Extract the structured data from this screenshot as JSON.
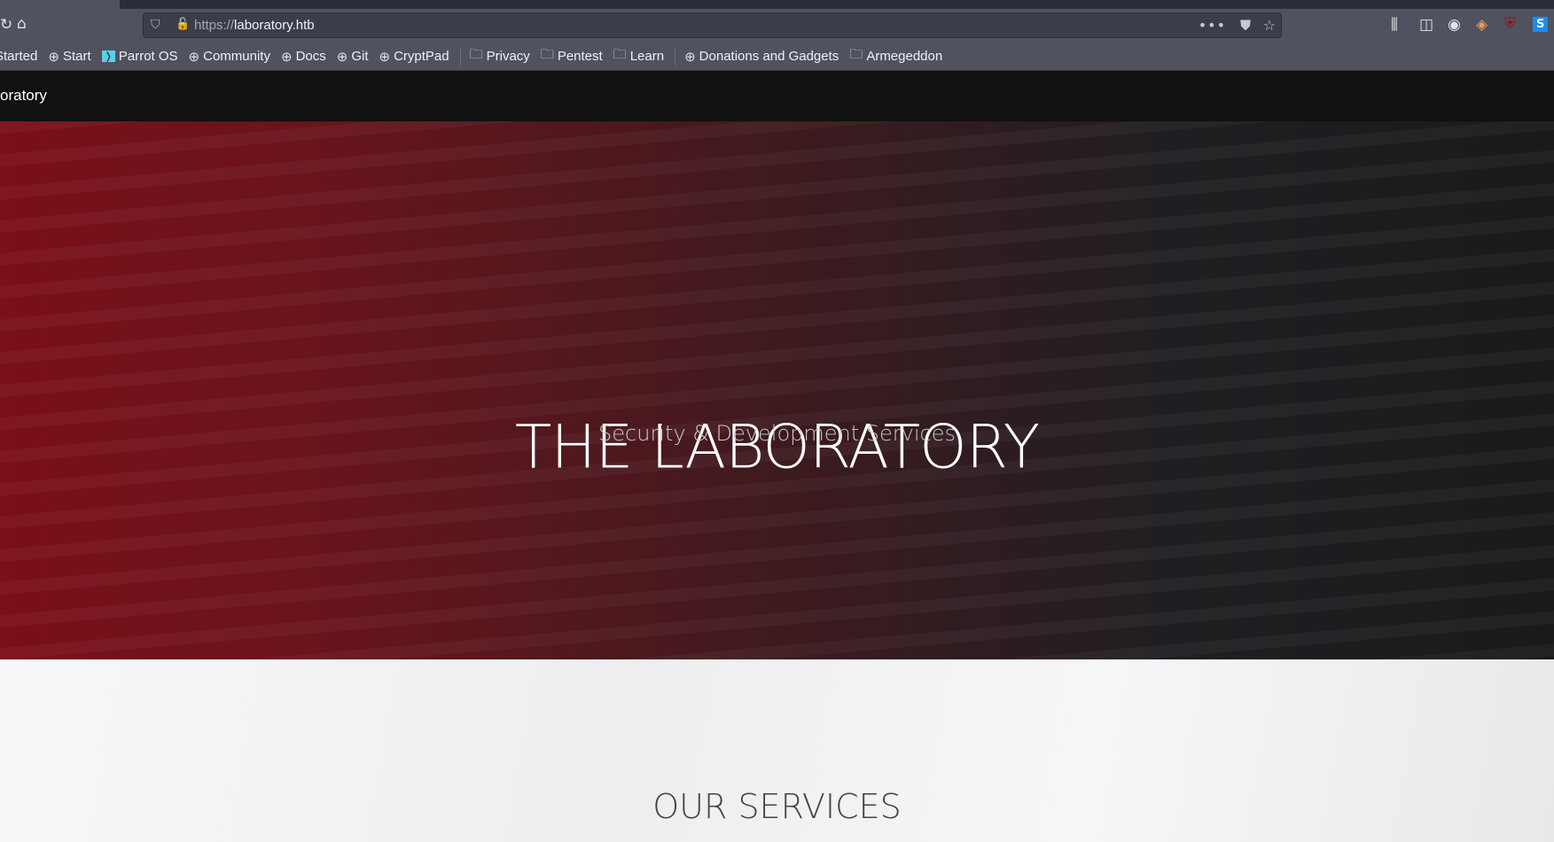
{
  "browser": {
    "url_protocol": "https://",
    "url_host": "laboratory.htb",
    "bookmarks": [
      {
        "label": "Started",
        "icon": "none"
      },
      {
        "label": "Start",
        "icon": "globe-icon"
      },
      {
        "label": "Parrot OS",
        "icon": "parrot-icon"
      },
      {
        "label": "Community",
        "icon": "globe-icon"
      },
      {
        "label": "Docs",
        "icon": "globe-icon"
      },
      {
        "label": "Git",
        "icon": "globe-icon"
      },
      {
        "label": "CryptPad",
        "icon": "globe-icon"
      },
      {
        "label": "Privacy",
        "icon": "folder-icon"
      },
      {
        "label": "Pentest",
        "icon": "folder-icon"
      },
      {
        "label": "Learn",
        "icon": "folder-icon"
      },
      {
        "label": "Donations and Gadgets",
        "icon": "globe-icon"
      },
      {
        "label": "Armegeddon",
        "icon": "folder-icon"
      }
    ]
  },
  "site": {
    "brand": "oratory",
    "hero_title": "THE LABORATORY",
    "hero_subtitle": "Security & Development Services",
    "services_title": "OUR SERVICES"
  }
}
